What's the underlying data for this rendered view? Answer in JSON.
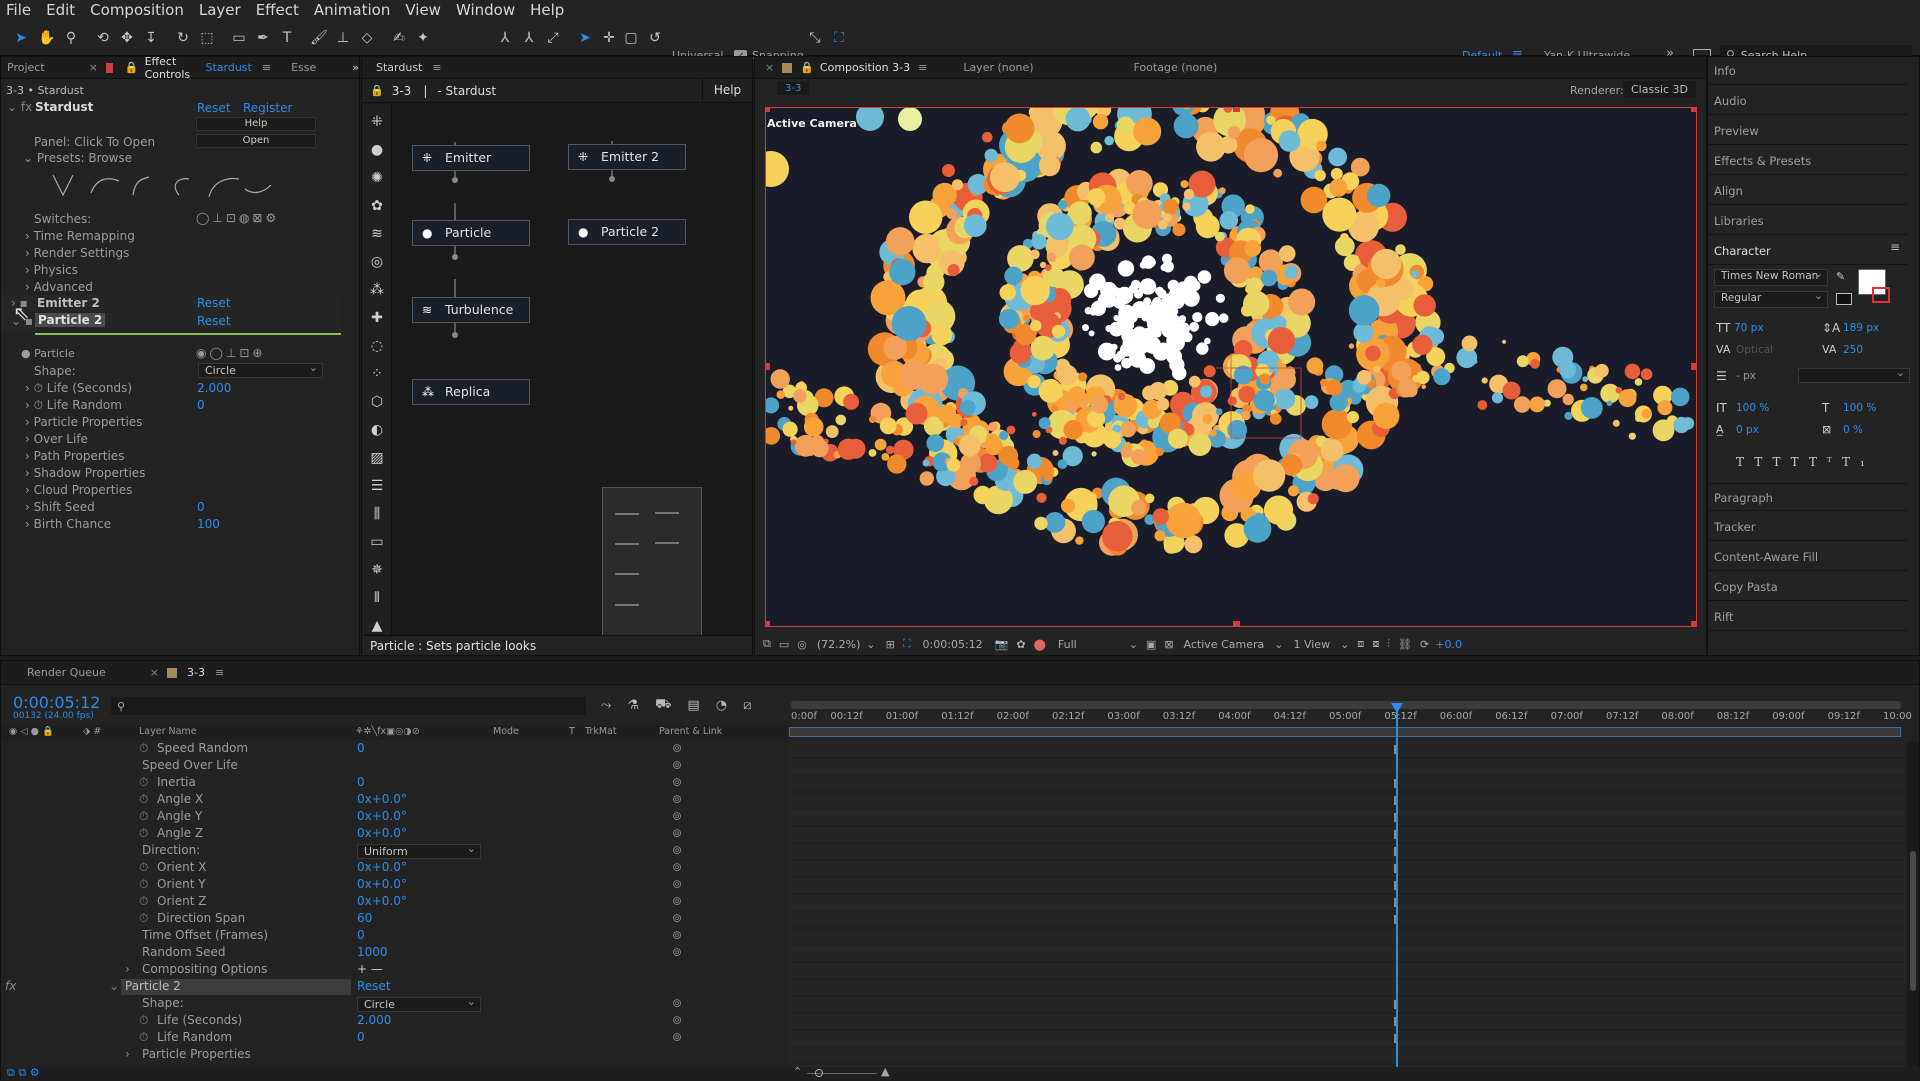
{
  "menu": [
    "File",
    "Edit",
    "Composition",
    "Layer",
    "Effect",
    "Animation",
    "View",
    "Window",
    "Help"
  ],
  "toolbar": {
    "universal": "Universal",
    "snapping": "Snapping",
    "workspace_default": "Default",
    "workspace_alt": "Yan-K Ultrawide",
    "search_placeholder": "Search Help"
  },
  "left_panel": {
    "tabs": [
      "Project",
      "Effect Controls",
      "Stardust",
      "Esse"
    ],
    "breadcrumb": "3-3 • Stardust",
    "effect_name": "Stardust",
    "reset": "Reset",
    "register": "Register",
    "help_btn": "Help",
    "open_btn": "Open",
    "panel_label": "Panel: Click To Open",
    "presets_label": "Presets: Browse",
    "switches_label": "Switches:",
    "groups": [
      "Time Remapping",
      "Render Settings",
      "Physics",
      "Advanced"
    ],
    "emitter2": "Emitter 2",
    "particle2": "Particle 2",
    "particle_label": "Particle",
    "shape_label": "Shape:",
    "shape_value": "Circle",
    "props": [
      {
        "label": "Life (Seconds)",
        "value": "2.000"
      },
      {
        "label": "Life Random",
        "value": "0"
      }
    ],
    "subgroups": [
      "Particle Properties",
      "Over Life",
      "Path Properties",
      "Shadow Properties",
      "Cloud Properties"
    ],
    "shift_seed": {
      "label": "Shift Seed",
      "value": "0"
    },
    "birth_chance": {
      "label": "Birth Chance",
      "value": "100"
    }
  },
  "node_panel": {
    "tab": "Stardust",
    "comp": "3-3",
    "sep": "|",
    "title": "- Stardust",
    "help": "Help",
    "nodes": [
      "Emitter",
      "Emitter 2",
      "Particle",
      "Particle 2",
      "Turbulence",
      "Replica"
    ],
    "status": "Particle : Sets particle looks"
  },
  "comp_panel": {
    "tabs": [
      "Composition 3-3",
      "Layer (none)",
      "Footage (none)"
    ],
    "subtab": "3-3",
    "renderer_label": "Renderer:",
    "renderer": "Classic 3D",
    "camera_label": "Active Camera",
    "zoom": "(72.2%)",
    "time": "0:00:05:12",
    "quality": "Full",
    "view_camera": "Active Camera",
    "views": "1 View",
    "exposure": "+0.0"
  },
  "right_panel": {
    "items_top": [
      "Info",
      "Audio",
      "Preview",
      "Effects & Presets",
      "Align",
      "Libraries"
    ],
    "character": "Character",
    "font": "Times New Roman",
    "style": "Regular",
    "font_size": "70 px",
    "leading": "189 px",
    "kerning": "Optical",
    "tracking": "250",
    "stroke": "- px",
    "vscale": "100 %",
    "hscale": "100 %",
    "baseline": "0 px",
    "tsume": "0 %",
    "items_bottom": [
      "Paragraph",
      "Tracker",
      "Content-Aware Fill",
      "Copy Pasta",
      "Rift"
    ]
  },
  "timeline": {
    "tabs": [
      "Render Queue",
      "3-3"
    ],
    "timecode": "0:00:05:12",
    "frames": "00132 (24.00 fps)",
    "columns": [
      "Layer Name",
      "Mode",
      "T",
      "TrkMat",
      "Parent & Link"
    ],
    "ruler": [
      "0:00f",
      "00:12f",
      "01:00f",
      "01:12f",
      "02:00f",
      "02:12f",
      "03:00f",
      "03:12f",
      "04:00f",
      "04:12f",
      "05:00f",
      "05:12f",
      "06:00f",
      "06:12f",
      "07:00f",
      "07:12f",
      "08:00f",
      "08:12f",
      "09:00f",
      "09:12f",
      "10:00"
    ],
    "rows": [
      {
        "label": "Speed Random",
        "value": "0",
        "stopwatch": true
      },
      {
        "label": "Speed Over Life",
        "value": "",
        "stopwatch": false
      },
      {
        "label": "Inertia",
        "value": "0",
        "stopwatch": true
      },
      {
        "label": "Angle X",
        "value": "0x+0.0°",
        "stopwatch": true
      },
      {
        "label": "Angle Y",
        "value": "0x+0.0°",
        "stopwatch": true
      },
      {
        "label": "Angle Z",
        "value": "0x+0.0°",
        "stopwatch": true
      },
      {
        "label": "Direction:",
        "value": "Uniform",
        "stopwatch": false
      },
      {
        "label": "Orient X",
        "value": "0x+0.0°",
        "stopwatch": true
      },
      {
        "label": "Orient Y",
        "value": "0x+0.0°",
        "stopwatch": true
      },
      {
        "label": "Orient Z",
        "value": "0x+0.0°",
        "stopwatch": true
      },
      {
        "label": "Direction Span",
        "value": "60",
        "stopwatch": true
      },
      {
        "label": "Time Offset (Frames)",
        "value": "0",
        "stopwatch": false
      },
      {
        "label": "Random Seed",
        "value": "1000",
        "stopwatch": false
      },
      {
        "label": "Compositing Options",
        "value": "+ —",
        "stopwatch": false
      },
      {
        "label": "Particle 2",
        "value": "Reset",
        "stopwatch": false
      },
      {
        "label": "Shape:",
        "value": "Circle",
        "stopwatch": false
      },
      {
        "label": "Life (Seconds)",
        "value": "2.000",
        "stopwatch": true
      },
      {
        "label": "Life Random",
        "value": "0",
        "stopwatch": true
      },
      {
        "label": "Particle Properties",
        "value": "",
        "stopwatch": false
      }
    ]
  },
  "colors": {
    "accent": "#2d8ceb",
    "panel": "#232323",
    "bg": "#1d1d1d",
    "viewer": "#1a1d29"
  }
}
